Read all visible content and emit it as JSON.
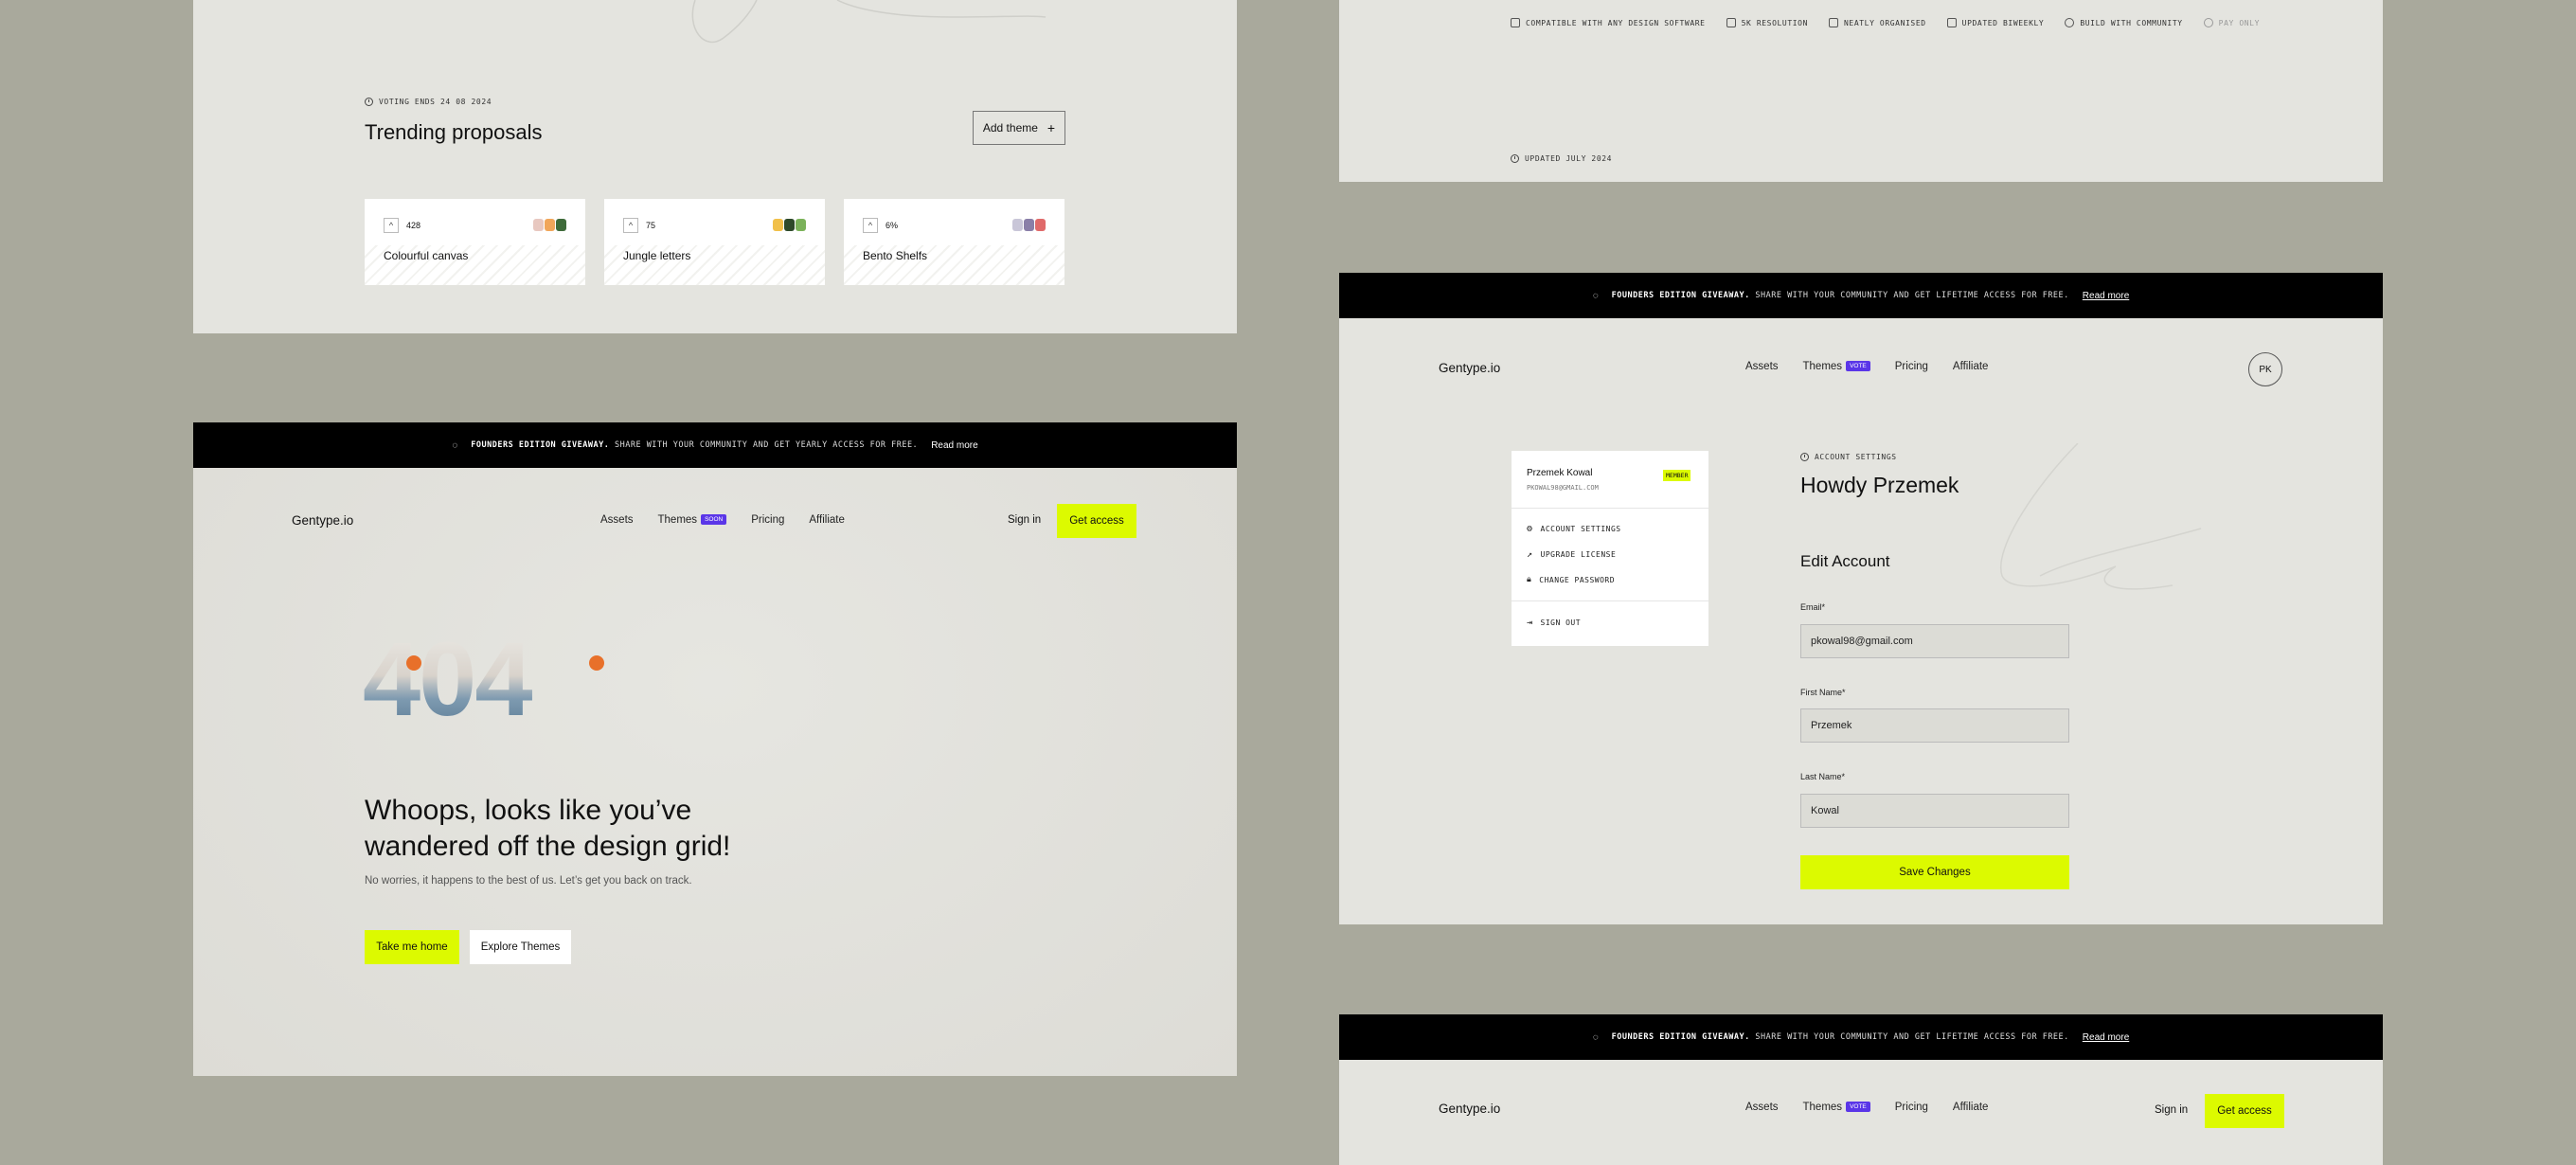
{
  "colors": {
    "accent": "#dcfa00",
    "badge": "#5a36e8",
    "banner": "#000000",
    "panel": "#e4e4df",
    "background": "#a9a99c"
  },
  "proposals": {
    "voting_meta": "VOTING ENDS 24 08 2024",
    "title": "Trending proposals",
    "add_button": "Add theme",
    "cards": [
      {
        "votes": "428",
        "name": "Colourful canvas"
      },
      {
        "votes": "75",
        "name": "Jungle letters"
      },
      {
        "votes": "6%",
        "name": "Bento Shelfs"
      }
    ]
  },
  "features": {
    "items": [
      "COMPATIBLE WITH ANY DESIGN SOFTWARE",
      "5K RESOLUTION",
      "NEATLY ORGANISED",
      "UPDATED BIWEEKLY",
      "BUILD WITH COMMUNITY",
      "PAY ONLY"
    ],
    "updated": "UPDATED JULY 2024"
  },
  "banner_yearly": {
    "lead": "FOUNDERS EDITION GIVEAWAY.",
    "text": "SHARE WITH YOUR COMMUNITY AND GET YEARLY ACCESS FOR FREE.",
    "link": "Read more"
  },
  "banner_lifetime": {
    "lead": "FOUNDERS EDITION GIVEAWAY.",
    "text": "SHARE WITH YOUR COMMUNITY AND GET LIFETIME ACCESS FOR FREE.",
    "link": "Read more"
  },
  "nav": {
    "logo": "Gentype.io",
    "assets": "Assets",
    "themes": "Themes",
    "badge_soon": "SOON",
    "badge_vote": "VOTE",
    "pricing": "Pricing",
    "affiliate": "Affiliate",
    "sign_in": "Sign in",
    "get_access": "Get access",
    "avatar": "PK"
  },
  "error_page": {
    "code": "404",
    "headline_line1": "Whoops, looks like you’ve",
    "headline_line2": "wandered off the design grid!",
    "sub": "No worries, it happens to the best of us. Let’s get you back on track.",
    "home_button": "Take me home",
    "explore_button": "Explore Themes"
  },
  "account": {
    "user_name": "Przemek Kowal",
    "user_email": "PKOWAL98@GMAIL.COM",
    "member_badge": "MEMBER",
    "menu": [
      "ACCOUNT SETTINGS",
      "UPGRADE LICENSE",
      "CHANGE PASSWORD"
    ],
    "sign_out": "SIGN OUT",
    "meta": "ACCOUNT SETTINGS",
    "greeting": "Howdy Przemek",
    "section_title": "Edit Account",
    "email_label": "Email*",
    "email_value": "pkowal98@gmail.com",
    "first_label": "First Name*",
    "first_value": "Przemek",
    "last_label": "Last Name*",
    "last_value": "Kowal",
    "save_button": "Save Changes"
  }
}
